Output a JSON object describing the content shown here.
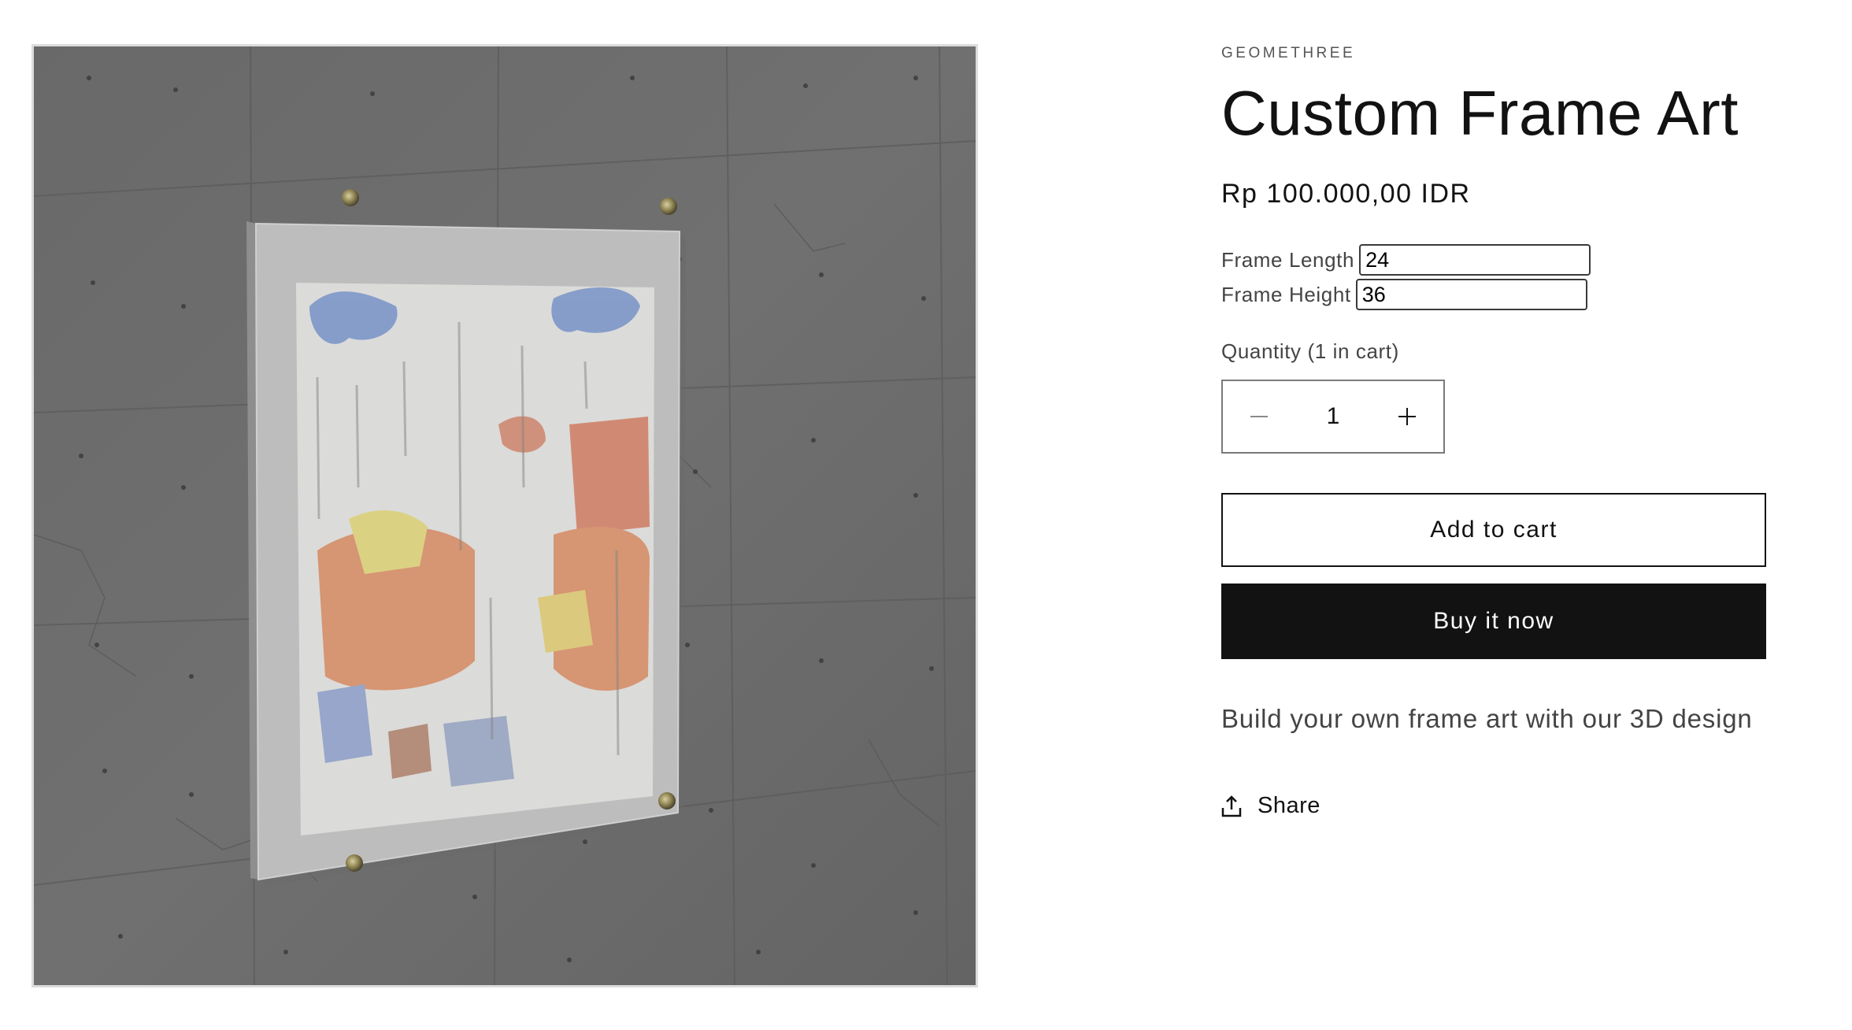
{
  "product": {
    "vendor": "GEOMETHREE",
    "title": "Custom Frame Art",
    "price": "Rp 100.000,00 IDR",
    "description": "Build your own frame art with our 3D design"
  },
  "properties": [
    {
      "label": "Frame Length",
      "value": "24"
    },
    {
      "label": "Frame Height",
      "value": "36"
    }
  ],
  "quantity": {
    "label": "Quantity (1 in cart)",
    "value": "1",
    "decrease_icon": "minus-icon",
    "increase_icon": "plus-icon"
  },
  "actions": {
    "add_to_cart": "Add to cart",
    "buy_now": "Buy it now",
    "share": "Share",
    "share_icon": "share-icon"
  },
  "colors": {
    "primary": "#121212",
    "background": "#ffffff",
    "wall": "#6b6b6b"
  }
}
